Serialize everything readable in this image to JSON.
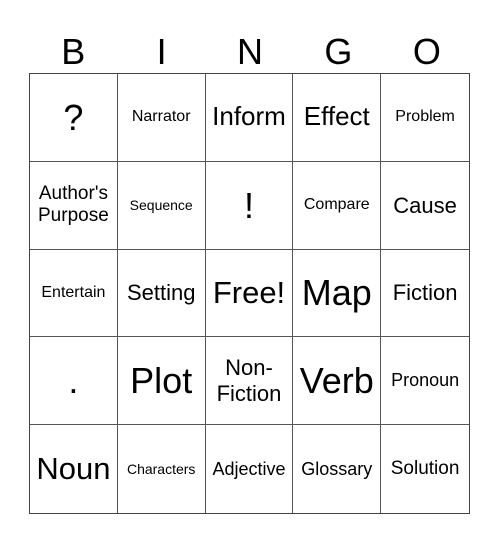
{
  "header": {
    "letters": [
      "B",
      "I",
      "N",
      "G",
      "O"
    ]
  },
  "cells": [
    "?",
    "Narrator",
    "Inform",
    "Effect",
    "Problem",
    "Author's Purpose",
    "Sequence",
    "!",
    "Compare",
    "Cause",
    "Entertain",
    "Setting",
    "Free!",
    "Map",
    "Fiction",
    ".",
    "Plot",
    "Non-Fiction",
    "Verb",
    "Pronoun",
    "Noun",
    "Characters",
    "Adjective",
    "Glossary",
    "Solution"
  ]
}
